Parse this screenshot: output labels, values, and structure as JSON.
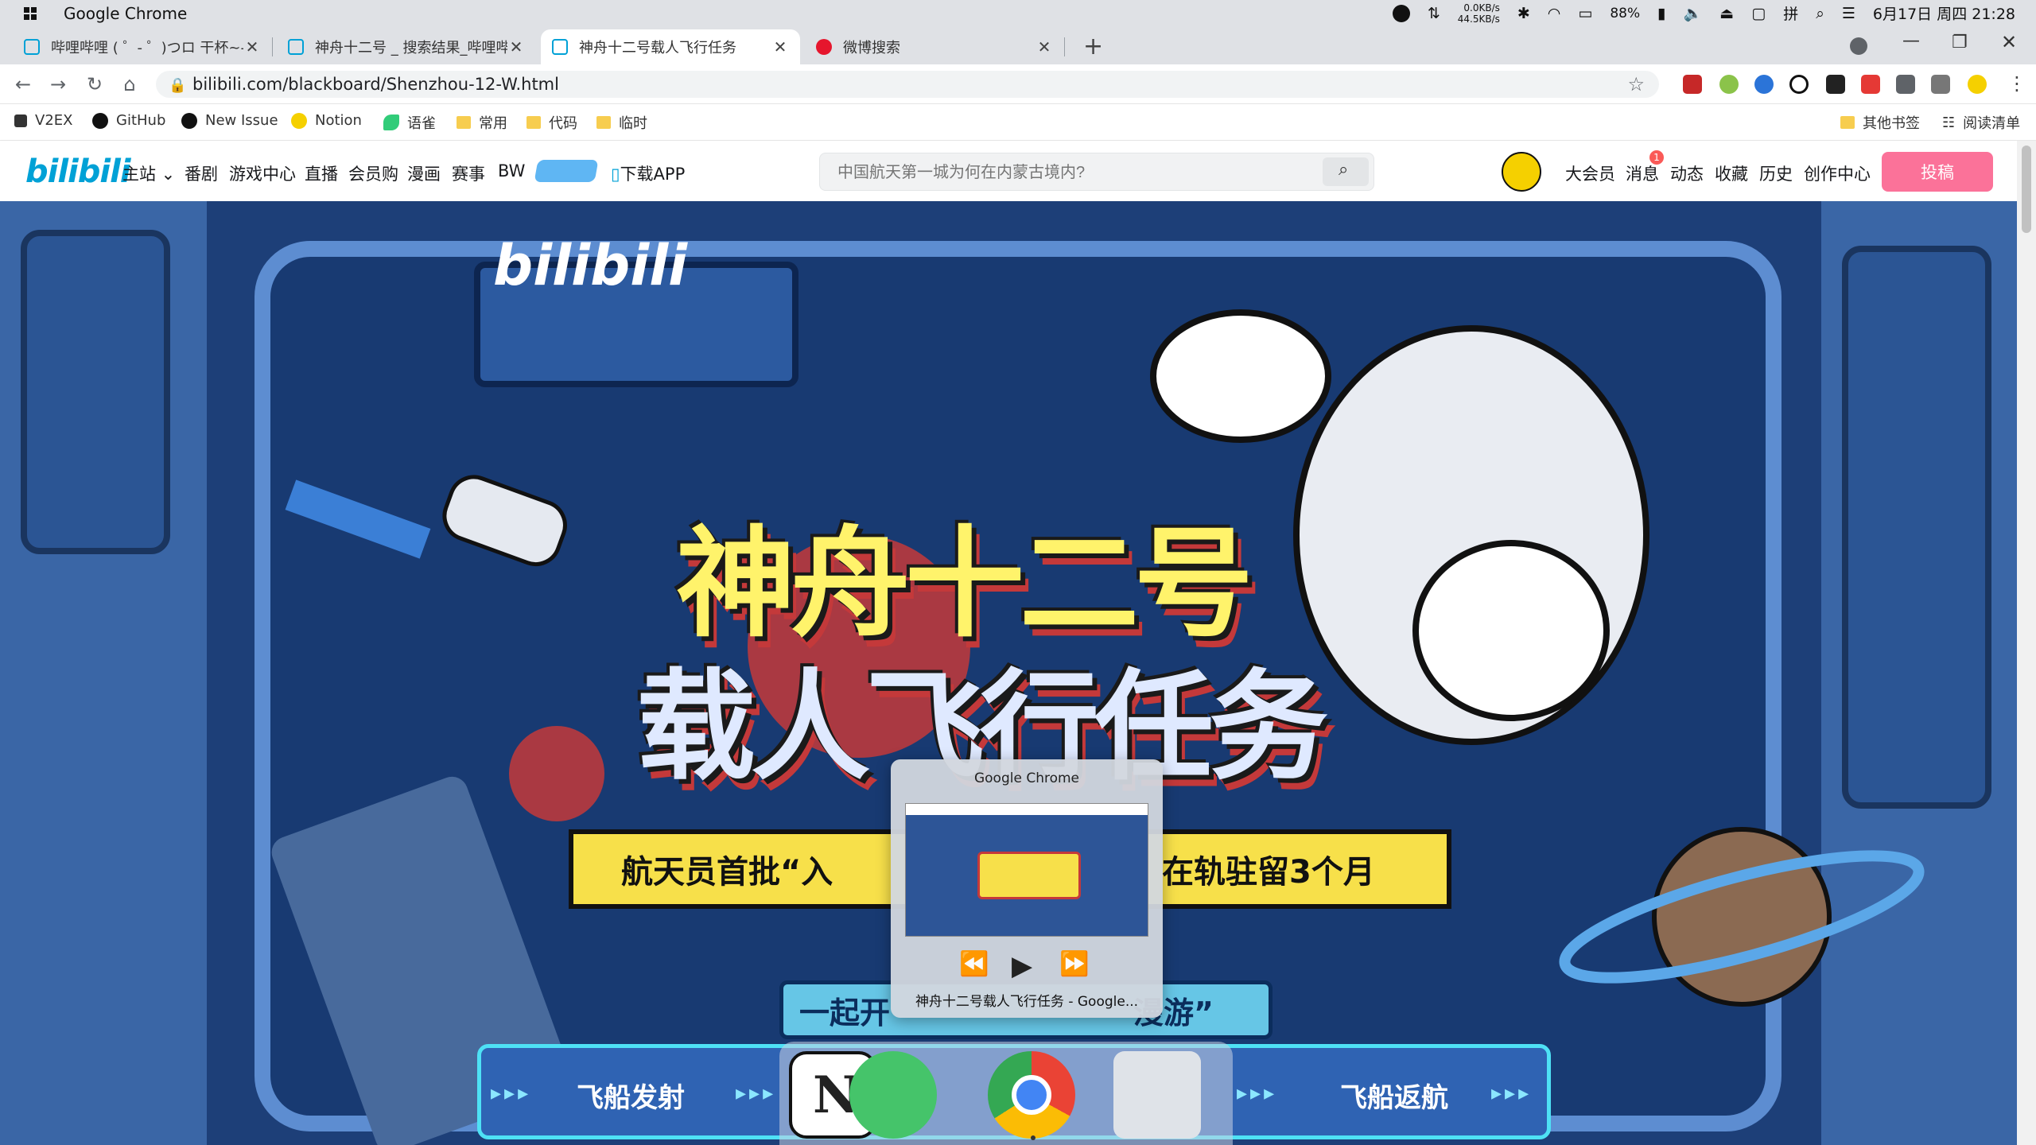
{
  "os": {
    "app_name": "Google Chrome",
    "net_up": "0.0KB/s",
    "net_down": "44.5KB/s",
    "battery": "88%",
    "ime": "拼",
    "clock": "6月17日 周四 21:28"
  },
  "tabs": [
    {
      "label": "哔哩哔哩 ( ゜- ゜)つロ 干杯~-bili",
      "active": false
    },
    {
      "label": "神舟十二号 _ 搜索结果_哔哩哔哩",
      "active": false
    },
    {
      "label": "神舟十二号载人飞行任务",
      "active": true
    },
    {
      "label": "微博搜索",
      "active": false
    }
  ],
  "address": {
    "url": "bilibili.com/blackboard/Shenzhou-12-W.html"
  },
  "bookmarks": {
    "items": [
      "V2EX",
      "GitHub",
      "New Issue",
      "Notion",
      "语雀",
      "常用",
      "代码",
      "临时"
    ],
    "other": "其他书签",
    "reading_list": "阅读清单"
  },
  "bili": {
    "logo": "bilibili",
    "nav": [
      "主站",
      "番剧",
      "游戏中心",
      "直播",
      "会员购",
      "漫画",
      "赛事",
      "BW",
      "下载APP"
    ],
    "search_placeholder": "中国航天第一城为何在内蒙古境内?",
    "right_nav": [
      "大会员",
      "消息",
      "动态",
      "收藏",
      "历史",
      "创作中心"
    ],
    "message_badge": "1",
    "upload_label": "投稿"
  },
  "hero": {
    "brand": "bilibili",
    "title_line1": "神舟十二号",
    "title_line2": "载人飞行任务",
    "banner_left": "航天员首批“入",
    "banner_right": "在轨驻留3个月",
    "cta_left": "一起开",
    "cta_right": "漫游”",
    "stages": [
      "飞船发射",
      "飞船返航"
    ]
  },
  "media_popup": {
    "app_title": "Google Chrome",
    "description": "神舟十二号载人飞行任务 - Google..."
  },
  "colors": {
    "bili_blue": "#00a1d6",
    "bili_pink": "#fb7299",
    "hero_bg": "#234a86"
  }
}
